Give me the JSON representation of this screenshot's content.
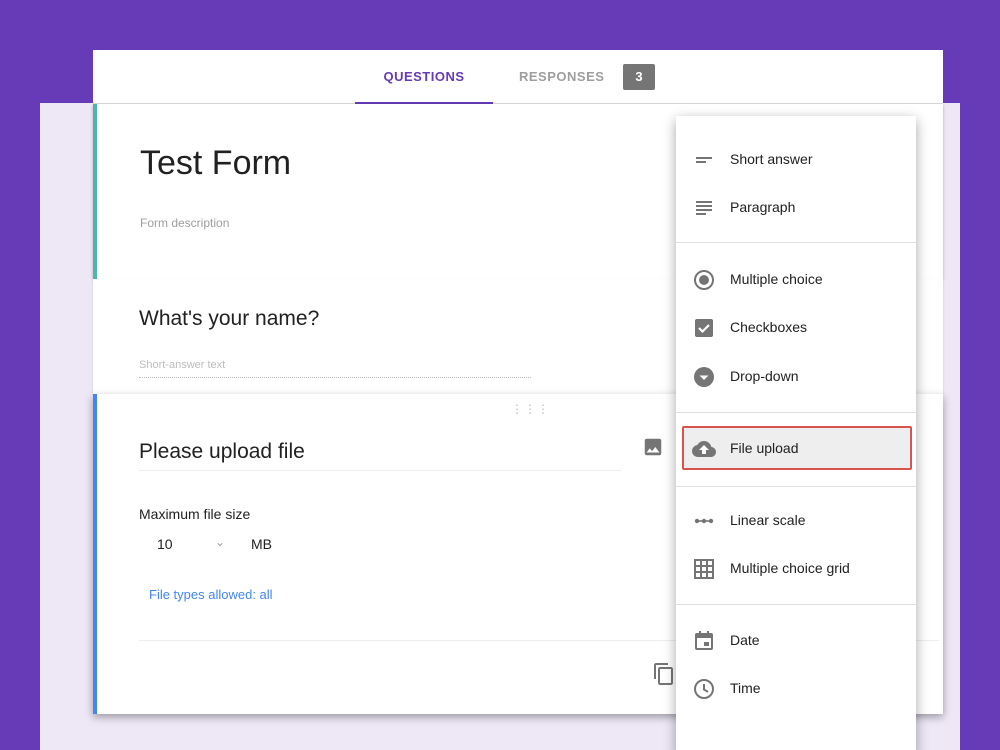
{
  "colors": {
    "brand": "#673ab7",
    "accent_link": "#4285f4",
    "highlight_border": "#d9534f"
  },
  "tabs": {
    "questions": "QUESTIONS",
    "responses": "RESPONSES",
    "responses_count": "3"
  },
  "form": {
    "title": "Test Form",
    "description_placeholder": "Form description"
  },
  "question1": {
    "title": "What's your name?",
    "answer_placeholder": "Short-answer text"
  },
  "question2": {
    "title": "Please upload file",
    "max_size_label": "Maximum file size",
    "max_size_value": "10",
    "max_size_unit": "MB",
    "file_types": "File types allowed: all"
  },
  "menu": {
    "items": [
      {
        "label": "Short answer",
        "icon": "short-answer-icon"
      },
      {
        "label": "Paragraph",
        "icon": "paragraph-icon"
      },
      {
        "label": "Multiple choice",
        "icon": "radio-icon"
      },
      {
        "label": "Checkboxes",
        "icon": "checkbox-icon"
      },
      {
        "label": "Drop-down",
        "icon": "dropdown-icon"
      },
      {
        "label": "File upload",
        "icon": "cloud-upload-icon",
        "selected": true
      },
      {
        "label": "Linear scale",
        "icon": "linear-scale-icon"
      },
      {
        "label": "Multiple choice grid",
        "icon": "grid-icon"
      },
      {
        "label": "Date",
        "icon": "calendar-icon"
      },
      {
        "label": "Time",
        "icon": "clock-icon"
      }
    ]
  }
}
